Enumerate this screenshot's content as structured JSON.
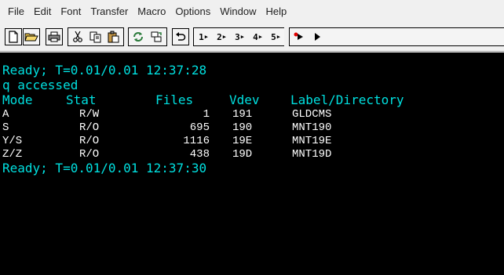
{
  "menu": [
    "File",
    "Edit",
    "Font",
    "Transfer",
    "Macro",
    "Options",
    "Window",
    "Help"
  ],
  "toolbar": {
    "number_buttons": [
      "1",
      "2",
      "3",
      "4",
      "5"
    ]
  },
  "terminal": {
    "ready1": "Ready; T=0.01/0.01 12:37:28",
    "accessed": "q accessed",
    "headers": {
      "mode": "Mode",
      "stat": "Stat",
      "files": "Files",
      "vdev": "Vdev",
      "label": "Label/Directory"
    },
    "rows": [
      {
        "mode": "A",
        "stat": "R/W",
        "files": "1",
        "vdev": "191",
        "label": "GLDCMS"
      },
      {
        "mode": "S",
        "stat": "R/O",
        "files": "695",
        "vdev": "190",
        "label": "MNT190"
      },
      {
        "mode": "Y/S",
        "stat": "R/O",
        "files": "1116",
        "vdev": "19E",
        "label": "MNT19E"
      },
      {
        "mode": "Z/Z",
        "stat": "R/O",
        "files": "438",
        "vdev": "19D",
        "label": "MNT19D"
      }
    ],
    "ready2": "Ready; T=0.01/0.01 12:37:30"
  },
  "colors": {
    "terminal_bg": "#000000",
    "terminal_cyan": "#00e0e0",
    "terminal_white": "#ffffff"
  }
}
